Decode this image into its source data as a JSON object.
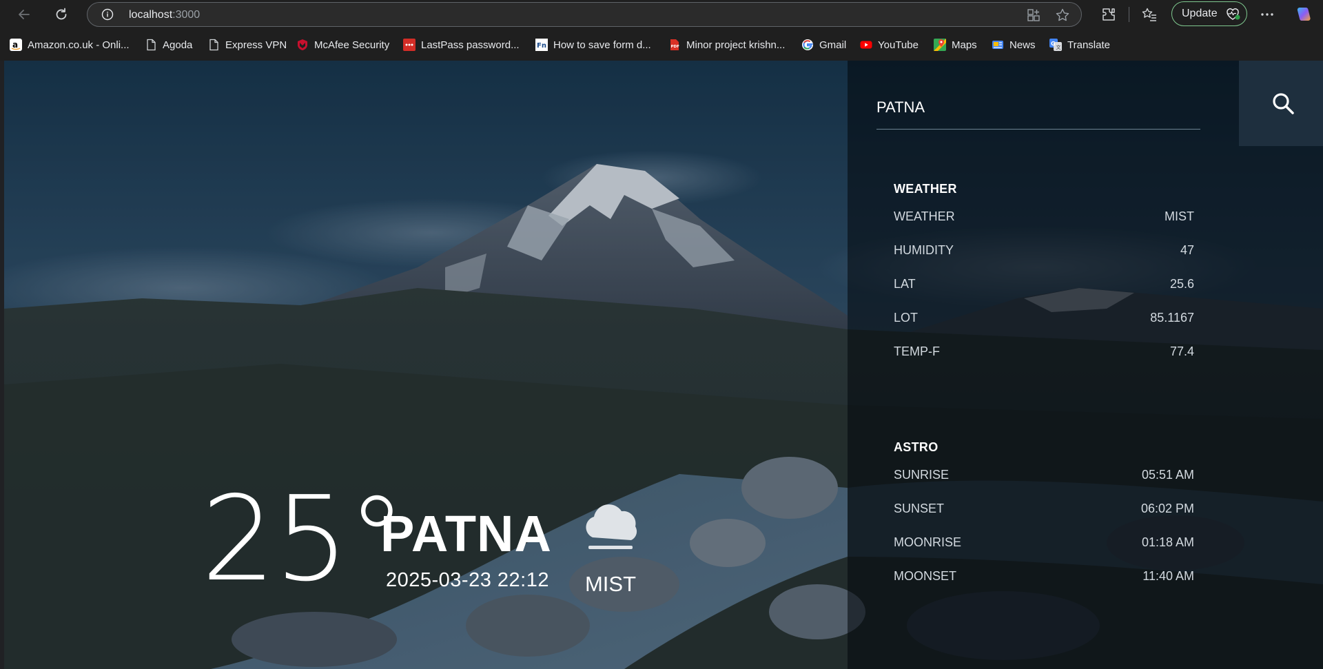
{
  "browser": {
    "url_host": "localhost",
    "url_port": ":3000",
    "update_label": "Update",
    "bookmarks": [
      {
        "label": "Amazon.co.uk - Onli...",
        "icon": "amazon-icon"
      },
      {
        "label": "Agoda",
        "icon": "page-icon"
      },
      {
        "label": "Express VPN",
        "icon": "page-icon"
      },
      {
        "label": "McAfee Security",
        "icon": "mcafee-icon"
      },
      {
        "label": "LastPass password...",
        "icon": "lastpass-icon"
      },
      {
        "label": "How to save form d...",
        "icon": "fn-icon"
      },
      {
        "label": "Minor project krishn...",
        "icon": "pdf-icon"
      },
      {
        "label": "Gmail",
        "icon": "google-icon"
      },
      {
        "label": "YouTube",
        "icon": "youtube-icon"
      },
      {
        "label": "Maps",
        "icon": "maps-icon"
      },
      {
        "label": "News",
        "icon": "news-icon"
      },
      {
        "label": "Translate",
        "icon": "translate-icon"
      }
    ]
  },
  "current": {
    "temperature": "25°",
    "city": "PATNA",
    "datetime": "2025-03-23 22:12",
    "condition": "MIST",
    "condition_icon": "cloud-mist-icon"
  },
  "search": {
    "value": "PATNA",
    "button_icon": "search-icon"
  },
  "weather": {
    "title": "WEATHER",
    "rows": [
      {
        "label": "WEATHER",
        "value": "MIST"
      },
      {
        "label": "HUMIDITY",
        "value": "47"
      },
      {
        "label": "LAT",
        "value": "25.6"
      },
      {
        "label": "LOT",
        "value": "85.1167"
      },
      {
        "label": "TEMP-F",
        "value": "77.4"
      }
    ]
  },
  "astro": {
    "title": "ASTRO",
    "rows": [
      {
        "label": "SUNRISE",
        "value": "05:51 AM"
      },
      {
        "label": "SUNSET",
        "value": "06:02 PM"
      },
      {
        "label": "MOONRISE",
        "value": "01:18 AM"
      },
      {
        "label": "MOONSET",
        "value": "11:40 AM"
      }
    ]
  },
  "colors": {
    "update_border": "#7fc98f",
    "panel_bg": "#0a0f16",
    "search_button_bg": "#1e2f3e"
  }
}
